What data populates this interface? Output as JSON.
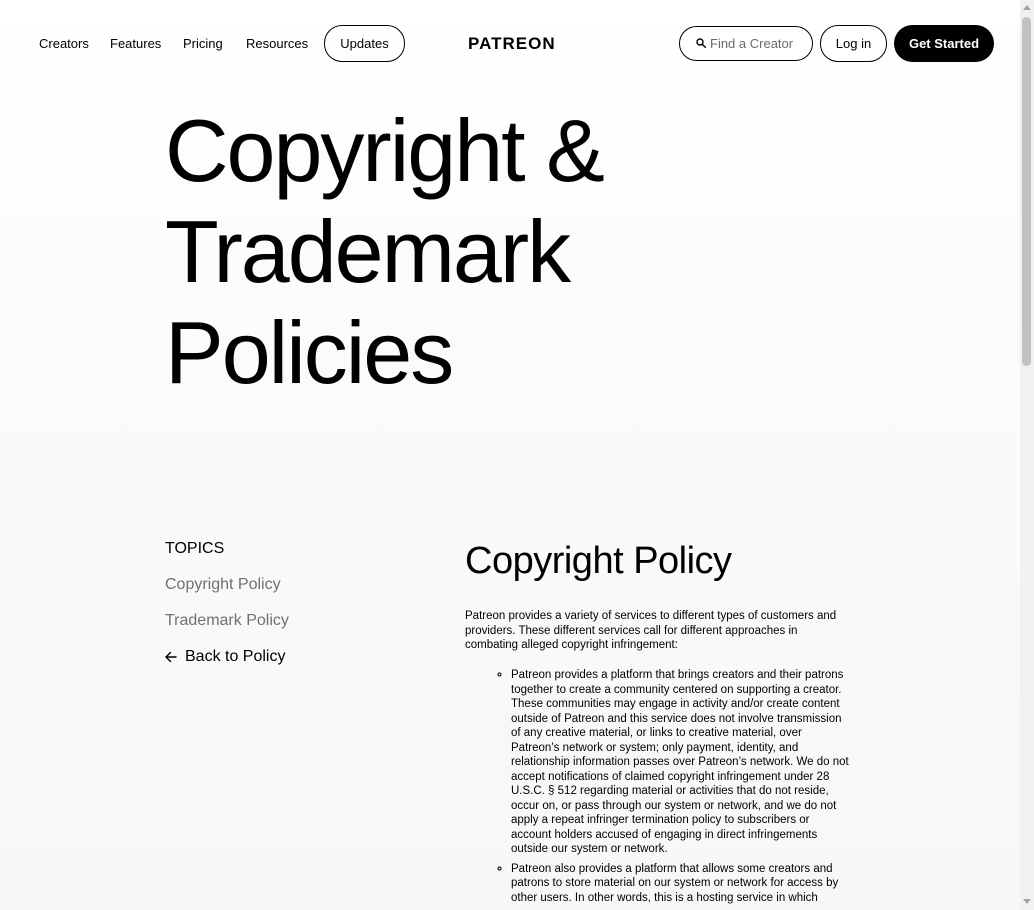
{
  "header": {
    "nav": [
      "Creators",
      "Features",
      "Pricing",
      "Resources"
    ],
    "updates_label": "Updates",
    "logo": "PATREON",
    "search_placeholder": "Find a Creator",
    "login_label": "Log in",
    "get_started_label": "Get Started"
  },
  "hero": {
    "title_lines": [
      "Copyright &",
      "Trademark",
      "Policies"
    ]
  },
  "topics": {
    "heading": "TOPICS",
    "items": [
      "Copyright Policy",
      "Trademark Policy"
    ],
    "back_label": "Back to Policy"
  },
  "content": {
    "title": "Copyright Policy",
    "intro": "Patreon provides a variety of services to different types of customers and providers. These different services call for different approaches in combating alleged copyright infringement:",
    "bullets": [
      "Patreon provides a platform that brings creators and their patrons together to create a community centered on supporting a creator. These communities may engage in activity and/or create content outside of Patreon and this service does not involve transmission of any creative material, or links to creative material, over Patreon’s network or system; only payment, identity, and relationship information passes over Patreon’s network. We do not accept notifications of claimed copyright infringement under 28 U.S.C. § 512 regarding material or activities that do not reside, occur on, or pass through our system or network, and we do not apply a repeat infringer termination policy to subscribers or account holders accused of engaging in direct infringements outside our system or network.",
      "Patreon also provides a platform that allows some creators and patrons to store material on our system or network for access by other users. In other words, this is a hosting service in which"
    ]
  }
}
